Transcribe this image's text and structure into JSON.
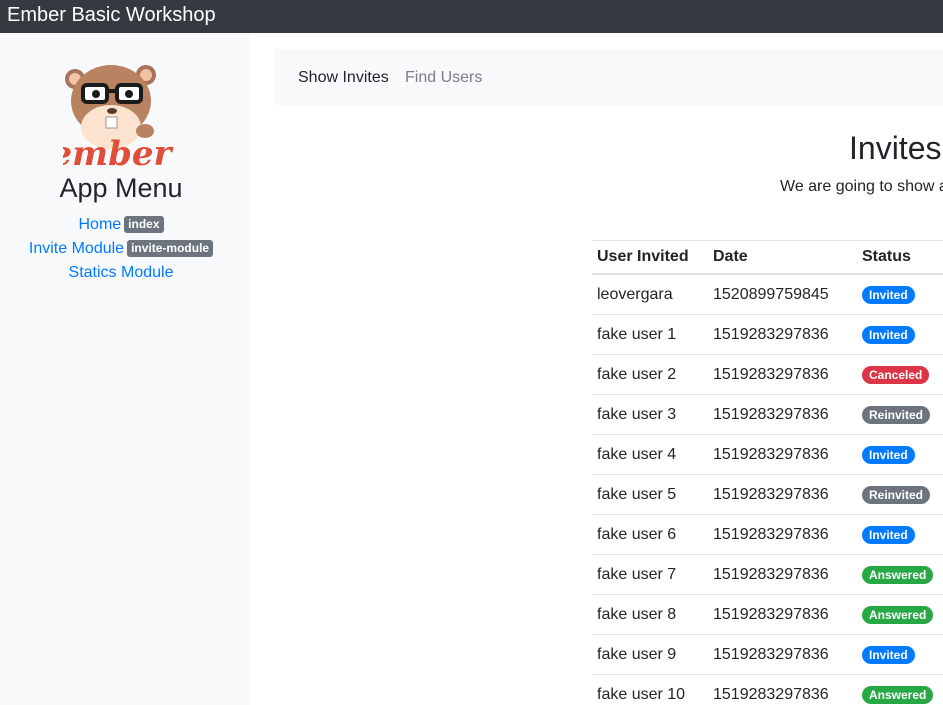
{
  "topbar": {
    "brand": "Ember Basic Workshop"
  },
  "sidebar": {
    "logo_text": "ember",
    "title": "App Menu",
    "items": [
      {
        "label": "Home",
        "tag": "index"
      },
      {
        "label": "Invite Module",
        "tag": "invite-module"
      },
      {
        "label": "Statics Module",
        "tag": ""
      }
    ]
  },
  "subnav": {
    "items": [
      "Show Invites",
      "Find Users"
    ],
    "active": "Show Invites"
  },
  "main": {
    "title": "Invites",
    "lead": "We are going to show a"
  },
  "table": {
    "columns": [
      "User Invited",
      "Date",
      "Status"
    ],
    "rows": [
      {
        "user": "leovergara",
        "date": "1520899759845",
        "status": "Invited"
      },
      {
        "user": "fake user 1",
        "date": "1519283297836",
        "status": "Invited"
      },
      {
        "user": "fake user 2",
        "date": "1519283297836",
        "status": "Canceled"
      },
      {
        "user": "fake user 3",
        "date": "1519283297836",
        "status": "Reinvited"
      },
      {
        "user": "fake user 4",
        "date": "1519283297836",
        "status": "Invited"
      },
      {
        "user": "fake user 5",
        "date": "1519283297836",
        "status": "Reinvited"
      },
      {
        "user": "fake user 6",
        "date": "1519283297836",
        "status": "Invited"
      },
      {
        "user": "fake user 7",
        "date": "1519283297836",
        "status": "Answered"
      },
      {
        "user": "fake user 8",
        "date": "1519283297836",
        "status": "Answered"
      },
      {
        "user": "fake user 9",
        "date": "1519283297836",
        "status": "Invited"
      },
      {
        "user": "fake user 10",
        "date": "1519283297836",
        "status": "Answered"
      }
    ]
  },
  "status_colors": {
    "Invited": "#007bff",
    "Canceled": "#dc3545",
    "Reinvited": "#6c757d",
    "Answered": "#28a745"
  },
  "colors": {
    "topbar": "#343a40",
    "link": "#007bff",
    "sidebar_bg": "#f8f9fa"
  }
}
